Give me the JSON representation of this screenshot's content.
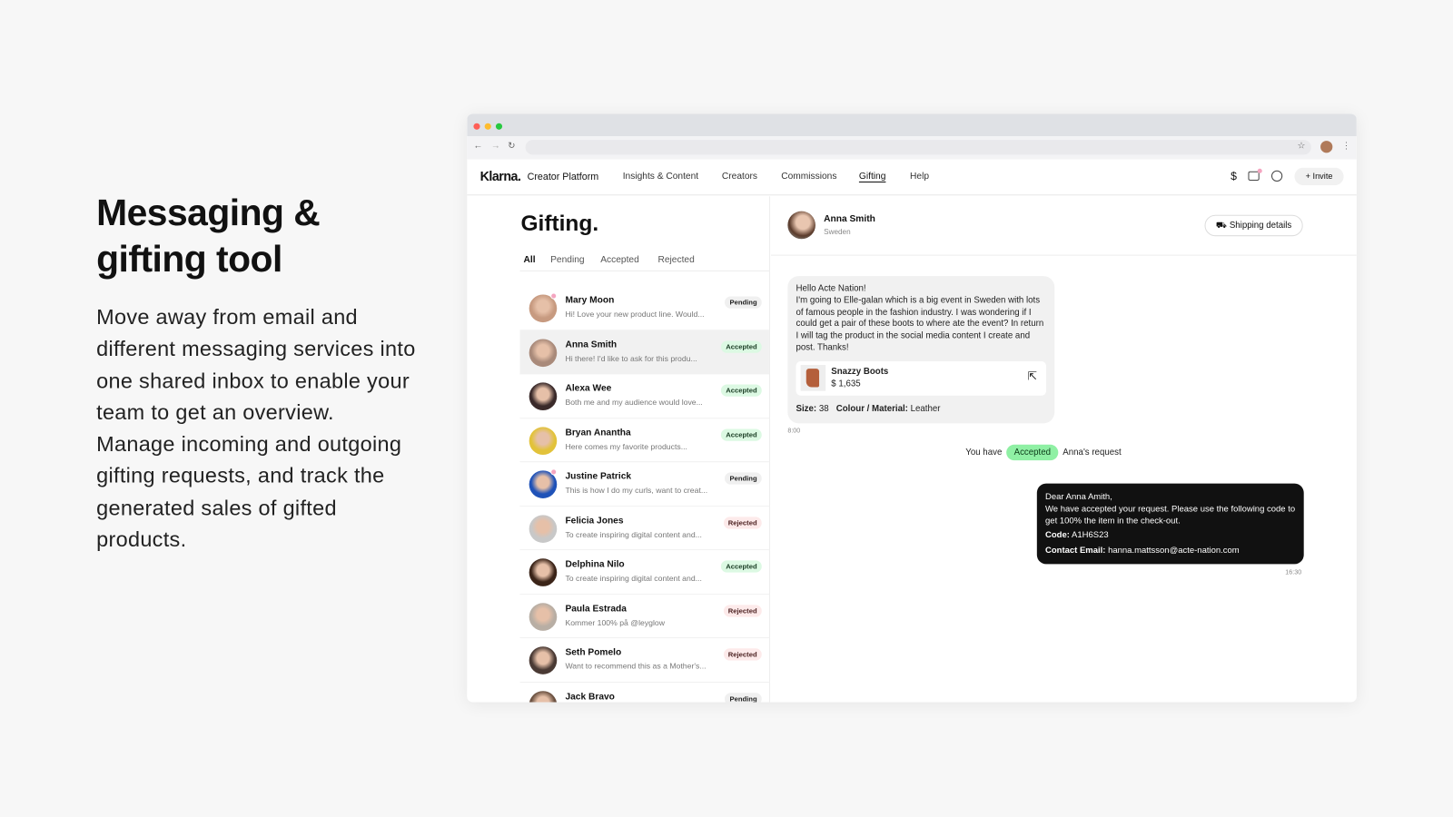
{
  "hero": {
    "title": "Messaging & gifting tool",
    "body": "Move away from email and different messaging services into one shared inbox to enable your team to get an overview. Manage incoming and outgoing gifting requests, and track the generated sales of gifted products."
  },
  "nav": {
    "logo": "Klarna.",
    "platform": "Creator Platform",
    "links": [
      "Insights & Content",
      "Creators",
      "Commissions",
      "Gifting",
      "Help"
    ],
    "active": "Gifting",
    "invite": "Invite",
    "icons": [
      "dollar-icon",
      "messages-icon",
      "account-icon"
    ]
  },
  "gifting": {
    "title": "Gifting.",
    "tabs": [
      "All",
      "Pending",
      "Accepted",
      "Rejected"
    ],
    "items": [
      {
        "name": "Mary Moon",
        "preview": "Hi! Love your new product line. Would...",
        "status": "Pending",
        "unread": true
      },
      {
        "name": "Anna Smith",
        "preview": "Hi there! I'd like to ask for this produ...",
        "status": "Accepted",
        "selected": true
      },
      {
        "name": "Alexa Wee",
        "preview": "Both me and my audience would love...",
        "status": "Accepted"
      },
      {
        "name": "Bryan Anantha",
        "preview": "Here comes my favorite products...",
        "status": "Accepted"
      },
      {
        "name": "Justine Patrick",
        "preview": "This is how I do my curls, want to creat...",
        "status": "Pending",
        "unread": true
      },
      {
        "name": "Felicia Jones",
        "preview": "To create inspiring digital content and...",
        "status": "Rejected"
      },
      {
        "name": "Delphina Nilo",
        "preview": "To create inspiring digital content and...",
        "status": "Accepted"
      },
      {
        "name": "Paula Estrada",
        "preview": "Kommer 100% på @leyglow",
        "status": "Rejected"
      },
      {
        "name": "Seth Pomelo",
        "preview": "Want to recommend this as a Mother's...",
        "status": "Rejected"
      },
      {
        "name": "Jack Bravo",
        "preview": "",
        "status": "Pending"
      }
    ]
  },
  "chat": {
    "name": "Anna Smith",
    "location": "Sweden",
    "shipping": "Shipping details",
    "message": "Hello Acte Nation!\nI'm going to Elle-galan which is a big event in Sweden with lots of famous people in the fashion industry. I was wondering if I could get a pair of these boots to where ate the event? In return I will tag the product in the social media content I create and post. Thanks!",
    "product": {
      "name": "Snazzy Boots",
      "price": "$ 1,635"
    },
    "size_label": "Size:",
    "size": "38",
    "material_label": "Colour / Material:",
    "material": "Leather",
    "time1": "8:00",
    "status_prefix": "You have",
    "status": "Accepted",
    "status_suffix": "Anna's request",
    "reply": {
      "greeting": "Dear Anna Amith,",
      "body": "We have accepted your request. Please use the following code to get 100% the item in the check-out.",
      "code_label": "Code:",
      "code": "A1H6S23",
      "email_label": "Contact Email:",
      "email": "hanna.mattsson@acte-nation.com"
    },
    "time2": "16:30"
  },
  "colors": {
    "accepted": "#dcf9e3",
    "rejected": "#fdeaea",
    "pending": "#f0f0f0",
    "accepted_pill": "#8ff0a4",
    "unread_dot": "#f4a5c0"
  }
}
